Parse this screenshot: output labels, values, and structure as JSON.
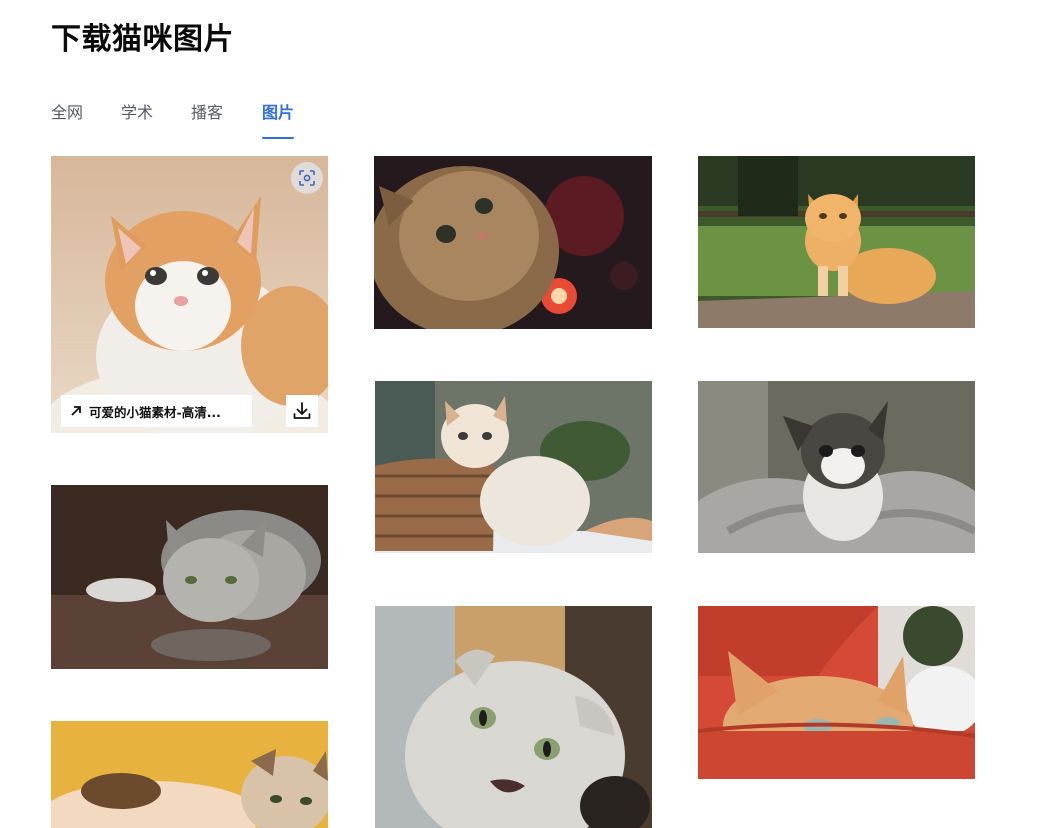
{
  "page": {
    "title": "下载猫咪图片"
  },
  "tabs": [
    {
      "label": "全网",
      "active": false
    },
    {
      "label": "学术",
      "active": false
    },
    {
      "label": "播客",
      "active": false
    },
    {
      "label": "图片",
      "active": true
    }
  ],
  "images": {
    "featured": {
      "caption": "可爱的小猫素材-高清...",
      "actions": [
        "visual-search-icon",
        "download-icon"
      ]
    }
  },
  "colors": {
    "accent": "#2f6fe4",
    "tab_text": "#555a66",
    "title_text": "#0b0b0b"
  }
}
